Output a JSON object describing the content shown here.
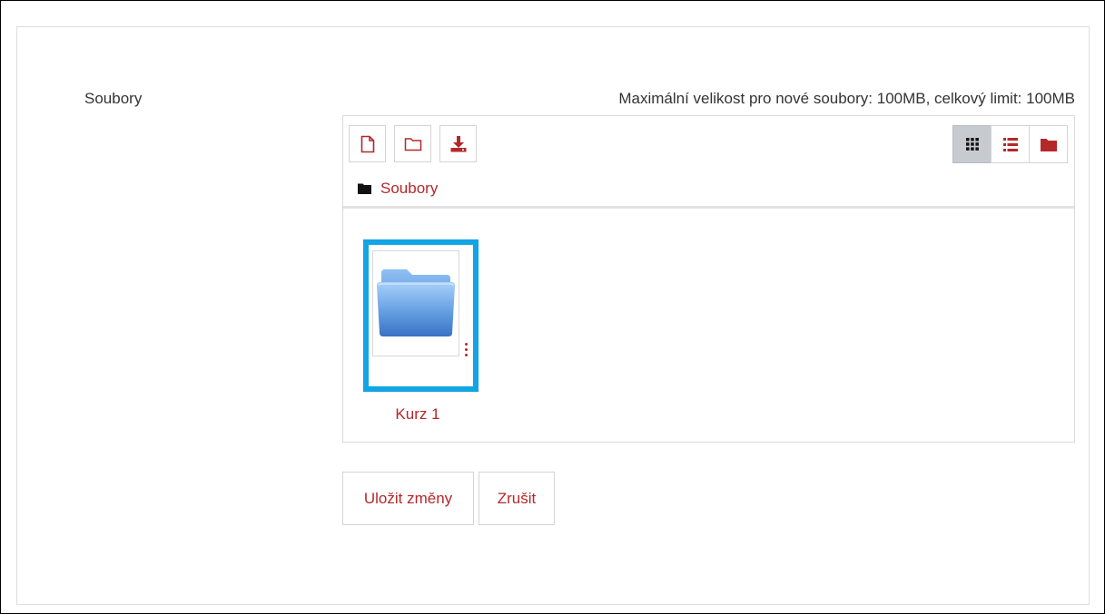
{
  "form": {
    "field_label": "Soubory",
    "limit_text": "Maximální velikost pro nové soubory: 100MB, celkový limit: 100MB"
  },
  "filemanager": {
    "toolbar": {
      "add_file_icon": "file-add-icon",
      "create_folder_icon": "folder-create-icon",
      "download_icon": "download-icon",
      "view_modes": [
        "grid-view-icon",
        "list-view-icon",
        "tree-view-icon"
      ],
      "active_view": "grid-view-icon"
    },
    "breadcrumb": {
      "icon": "folder-icon",
      "label": "Soubory"
    },
    "items": [
      {
        "name": "Kurz 1",
        "type_icon": "folder-icon",
        "selected": true
      }
    ]
  },
  "actions": {
    "save_label": "Uložit změny",
    "cancel_label": "Zrušit"
  },
  "colors": {
    "accent": "#b5282a",
    "selection_border": "#12a4e4",
    "active_view_bg": "#c7cbcf"
  }
}
